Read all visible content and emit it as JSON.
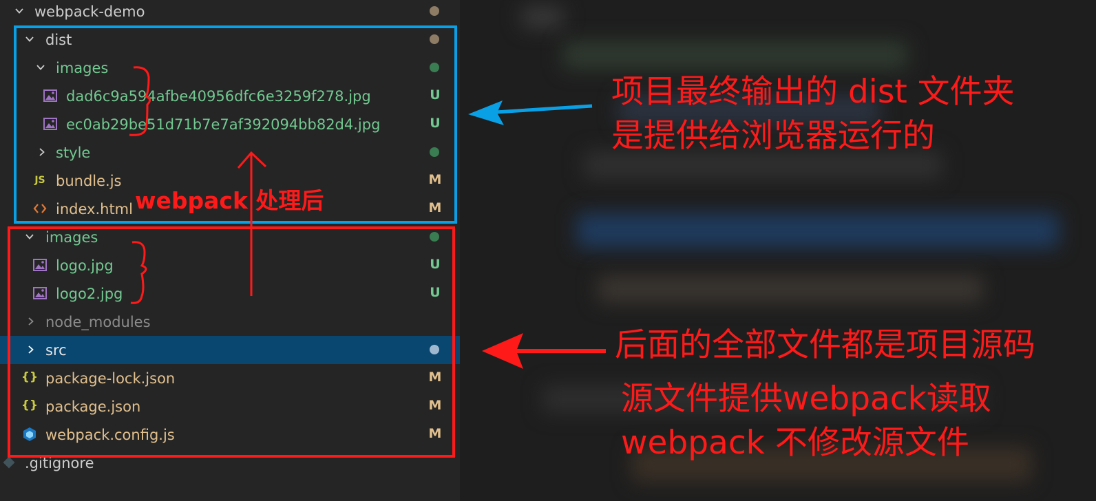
{
  "explorer": {
    "root": {
      "label": "webpack-demo"
    },
    "items": [
      {
        "label": "dist",
        "type": "folder-open",
        "status": "dot"
      },
      {
        "label": "images",
        "type": "folder-open",
        "status": "dot-green"
      },
      {
        "label": "dad6c9a594afbe40956dfc6e3259f278.jpg",
        "type": "image-file",
        "badge": "U"
      },
      {
        "label": "ec0ab29be51d71b7e7af392094bb82d4.jpg",
        "type": "image-file",
        "badge": "U"
      },
      {
        "label": "style",
        "type": "folder-closed",
        "status": "dot-green"
      },
      {
        "label": "bundle.js",
        "type": "js-file",
        "badge": "M"
      },
      {
        "label": "index.html",
        "type": "html-file",
        "badge": "M"
      },
      {
        "label": "images",
        "type": "folder-open",
        "status": "dot-green"
      },
      {
        "label": "logo.jpg",
        "type": "image-file",
        "badge": "U"
      },
      {
        "label": "logo2.jpg",
        "type": "image-file",
        "badge": "U"
      },
      {
        "label": "node_modules",
        "type": "folder-closed"
      },
      {
        "label": "src",
        "type": "folder-closed",
        "status": "dot",
        "selected": true
      },
      {
        "label": "package-lock.json",
        "type": "json-file",
        "badge": "M"
      },
      {
        "label": "package.json",
        "type": "json-file",
        "badge": "M"
      },
      {
        "label": "webpack.config.js",
        "type": "webpack-file",
        "badge": "M"
      },
      {
        "label": ".gitignore",
        "type": "git-file"
      }
    ]
  },
  "annotations": {
    "dist_note_line1": "项目最终输出的 dist 文件夹",
    "dist_note_line2": "是提供给浏览器运行的",
    "process_note": "webpack 处理后",
    "src_note_line1": "后面的全部文件都是项目源码",
    "src_note_line2": "源文件提供webpack读取",
    "src_note_line3": "webpack 不修改源文件"
  },
  "colors": {
    "annotation_red": "#ff1a1a",
    "annotation_blue": "#0aa0e6",
    "untracked_green": "#73c991",
    "modified_olive": "#e2c08d",
    "selection_blue": "#094771"
  }
}
